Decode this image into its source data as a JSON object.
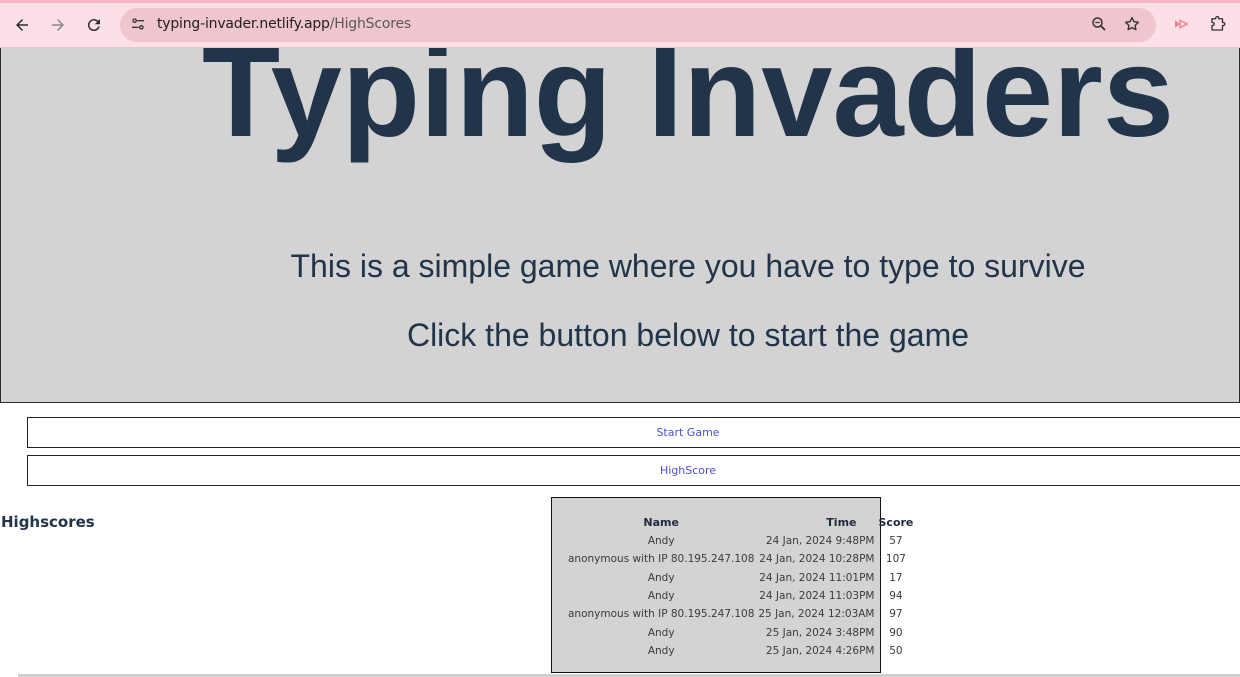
{
  "browser": {
    "url_host": "typing-invader.netlify.app",
    "url_path": "/HighScores"
  },
  "hero": {
    "title": "Typing Invaders",
    "subtitle_1": "This is a simple game where you have to type to survive",
    "subtitle_2": "Click the button below to start the game"
  },
  "buttons": {
    "start_label": "Start Game",
    "highscore_label": "HighScore"
  },
  "highscores": {
    "heading": "Highscores",
    "columns": {
      "name": "Name",
      "time": "Time",
      "score": "Score"
    },
    "rows": [
      {
        "name": "Andy",
        "time": "24 Jan, 2024 9:48PM",
        "score": "57"
      },
      {
        "name": "anonymous with IP 80.195.247.108",
        "time": "24 Jan, 2024 10:28PM",
        "score": "107"
      },
      {
        "name": "Andy",
        "time": "24 Jan, 2024 11:01PM",
        "score": "17"
      },
      {
        "name": "Andy",
        "time": "24 Jan, 2024 11:03PM",
        "score": "94"
      },
      {
        "name": "anonymous with IP 80.195.247.108",
        "time": "25 Jan, 2024 12:03AM",
        "score": "97"
      },
      {
        "name": "Andy",
        "time": "25 Jan, 2024 3:48PM",
        "score": "90"
      },
      {
        "name": "Andy",
        "time": "25 Jan, 2024 4:26PM",
        "score": "50"
      }
    ]
  },
  "colors": {
    "chrome_bg": "#fde0e7",
    "hero_bg": "#d3d3d3",
    "title_text": "#22344a",
    "link_text": "#4a4fd8"
  }
}
